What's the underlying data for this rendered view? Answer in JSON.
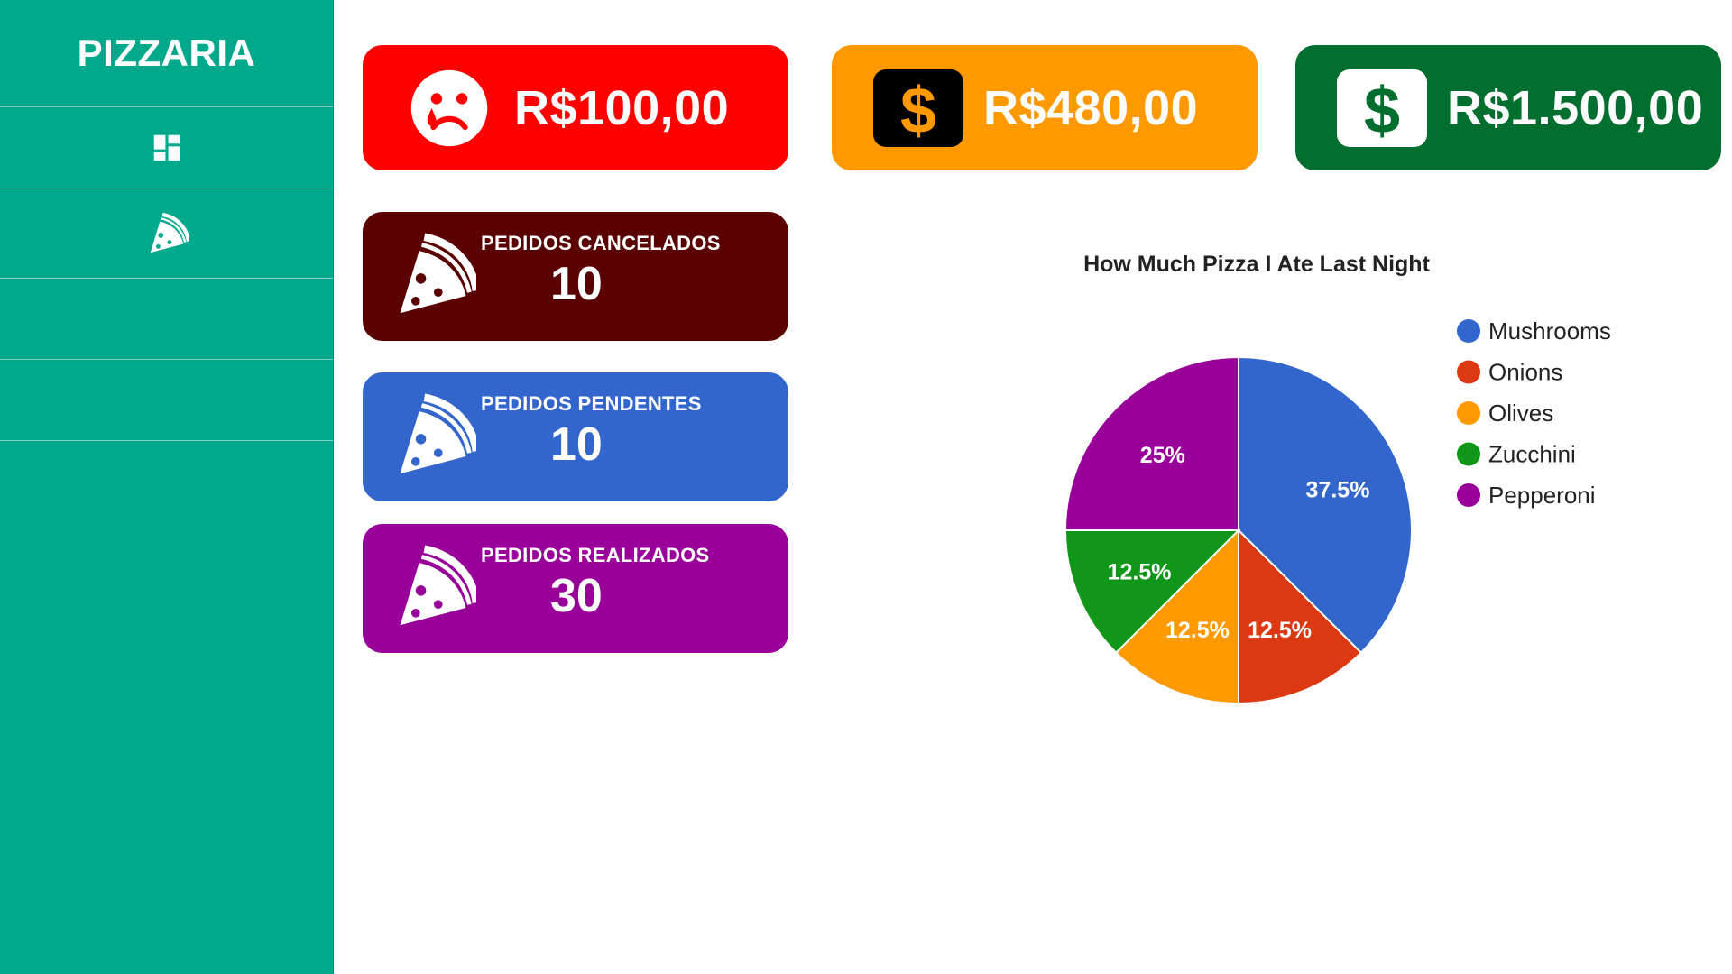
{
  "sidebar": {
    "brand": "PIZZARIA",
    "items": [
      {
        "icon": "dashboard-icon"
      },
      {
        "icon": "pizza-icon"
      },
      {
        "icon": ""
      },
      {
        "icon": ""
      }
    ]
  },
  "stats": [
    {
      "value": "R$100,00",
      "icon": "sad-face-icon",
      "color": "#ff0000"
    },
    {
      "value": "R$480,00",
      "icon": "dollar-icon",
      "color": "#ff9900"
    },
    {
      "value": "R$1.500,00",
      "icon": "dollar-icon",
      "color": "#006e2e"
    }
  ],
  "orders": [
    {
      "label": "PEDIDOS CANCELADOS",
      "count": "10",
      "icon": "pizza-icon",
      "color": "#5a0000"
    },
    {
      "label": "PEDIDOS PENDENTES",
      "count": "10",
      "icon": "pizza-icon",
      "color": "#3366cc"
    },
    {
      "label": "PEDIDOS REALIZADOS",
      "count": "30",
      "icon": "pizza-icon",
      "color": "#990099"
    }
  ],
  "chart_data": {
    "type": "pie",
    "title": "How Much Pizza I Ate Last Night",
    "legend_position": "right",
    "slices": [
      {
        "label": "Mushrooms",
        "value": 3,
        "percent_label": "37.5%",
        "color": "#3366cc"
      },
      {
        "label": "Onions",
        "value": 1,
        "percent_label": "12.5%",
        "color": "#dc3912"
      },
      {
        "label": "Olives",
        "value": 1,
        "percent_label": "12.5%",
        "color": "#ff9900"
      },
      {
        "label": "Zucchini",
        "value": 1,
        "percent_label": "12.5%",
        "color": "#109618"
      },
      {
        "label": "Pepperoni",
        "value": 2,
        "percent_label": "25%",
        "color": "#990099"
      }
    ]
  }
}
